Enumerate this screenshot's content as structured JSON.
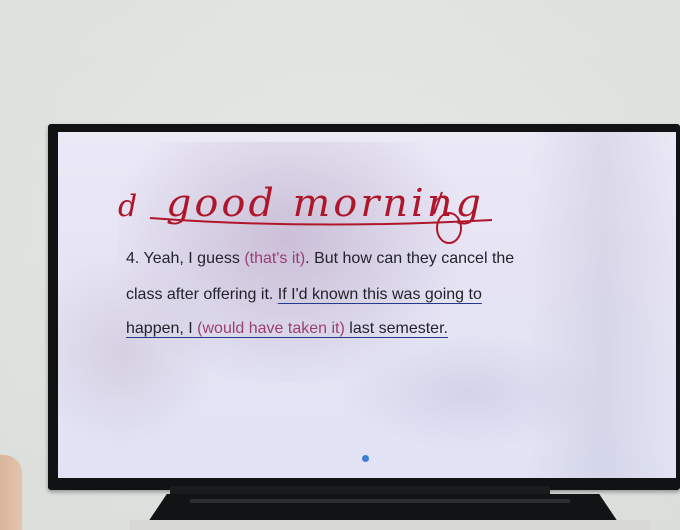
{
  "handwriting": {
    "prefix": "d",
    "main": "good morning"
  },
  "slide": {
    "line1": {
      "a": "4. Yeah, I guess ",
      "b": "(that's it)",
      "c": ". But how can they cancel the"
    },
    "line2": {
      "a": "class after offering it. ",
      "b": "If I'd known this was going to"
    },
    "line3": {
      "a": "happen, I ",
      "b": "(would have taken it)",
      "c": " last semester."
    }
  },
  "colors": {
    "ink_red": "#b0162a",
    "highlight_pink": "#9b3f74",
    "underline_blue": "#263a8c",
    "page_dot": "#3e7fd6"
  },
  "icons": [
    "page-indicator-dot-icon"
  ]
}
